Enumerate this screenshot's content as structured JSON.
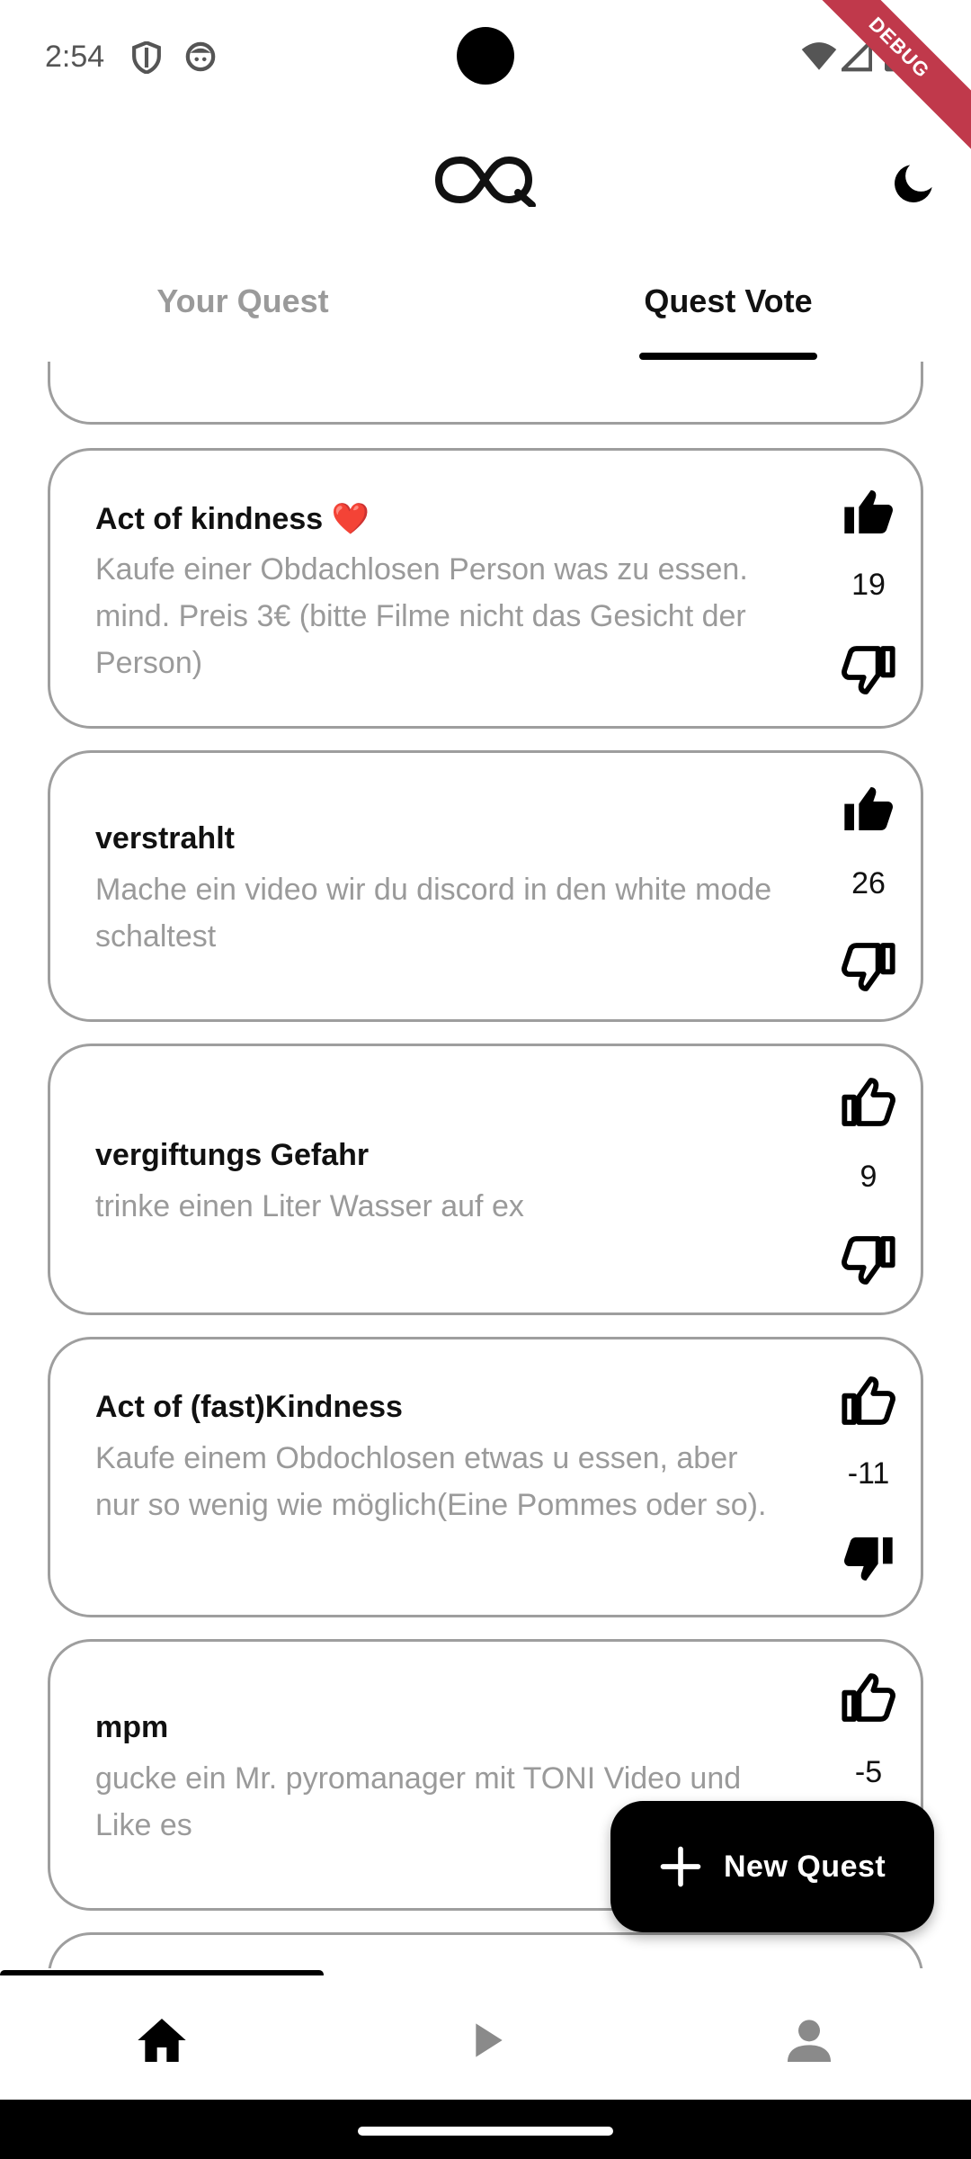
{
  "status_bar": {
    "time": "2:54",
    "icons": [
      "shield-icon",
      "face-icon",
      "wifi-icon",
      "signal-icon",
      "battery-icon"
    ],
    "debug_banner": "DEBUG"
  },
  "header": {
    "logo": "oq-logo-icon",
    "theme_toggle": "moon-icon"
  },
  "tabs": [
    {
      "label": "Your Quest",
      "selected": false
    },
    {
      "label": "Quest Vote",
      "selected": true
    }
  ],
  "quests": [
    {
      "title": "Act of kindness ❤️",
      "description": "Kaufe einer Obdachlosen Person was zu essen. mind. Preis 3€ (bitte Filme nicht das Gesicht der Person)",
      "votes": "19",
      "upvoted": true,
      "downvoted": false
    },
    {
      "title": "verstrahlt",
      "description": "Mache ein video wir du discord in den white mode schaltest",
      "votes": "26",
      "upvoted": true,
      "downvoted": false
    },
    {
      "title": "vergiftungs Gefahr",
      "description": "trinke  einen Liter Wasser auf ex",
      "votes": "9",
      "upvoted": false,
      "downvoted": false
    },
    {
      "title": "Act of (fast)Kindness",
      "description": "Kaufe einem Obdochlosen etwas u essen, aber nur so wenig wie möglich(Eine Pommes oder so).",
      "votes": "-11",
      "upvoted": false,
      "downvoted": true
    },
    {
      "title": "mpm",
      "description": "gucke ein Mr. pyromanager mit TONI Video und Like es",
      "votes": "-5",
      "upvoted": false,
      "downvoted": false
    }
  ],
  "fab": {
    "label": "New Quest",
    "icon": "plus-icon"
  },
  "bottom_nav": [
    {
      "icon": "home-icon",
      "selected": true
    },
    {
      "icon": "play-icon",
      "selected": false
    },
    {
      "icon": "person-icon",
      "selected": false
    }
  ],
  "colors": {
    "primary": "#000000",
    "muted_text": "#9a9a9a",
    "card_border": "#9e9e9e",
    "debug_ribbon": "#c0394b"
  }
}
